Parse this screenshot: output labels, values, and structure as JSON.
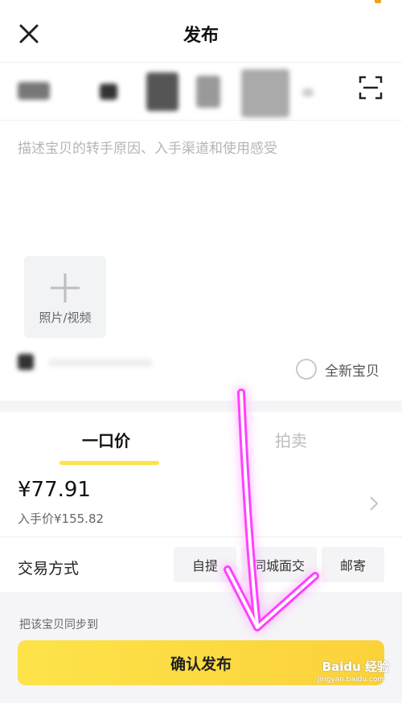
{
  "header": {
    "title": "发布",
    "close_icon": "close-icon",
    "accent": "#f0a020"
  },
  "title_row": {
    "scan_icon": "scan-icon"
  },
  "description": {
    "placeholder": "描述宝贝的转手原因、入手渠道和使用感受"
  },
  "media": {
    "add_label": "照片/视频",
    "icon": "plus-icon"
  },
  "condition": {
    "new_label": "全新宝贝",
    "checked": false
  },
  "pricing_tabs": {
    "fixed": "一口价",
    "auction": "拍卖",
    "active": "fixed",
    "underline_color": "#fde34a"
  },
  "price": {
    "value": "¥77.91",
    "original": "入手价¥155.82"
  },
  "trade": {
    "label": "交易方式",
    "options": [
      "自提",
      "同城面交",
      "邮寄"
    ]
  },
  "sync": {
    "label": "把该宝贝同步到"
  },
  "confirm": {
    "label": "确认发布",
    "color": "#fcd23a"
  },
  "watermark": {
    "text": "Baidu 经验",
    "sub": "jingyan.baidu.com"
  },
  "annotation": {
    "color": "#ff40ff"
  }
}
